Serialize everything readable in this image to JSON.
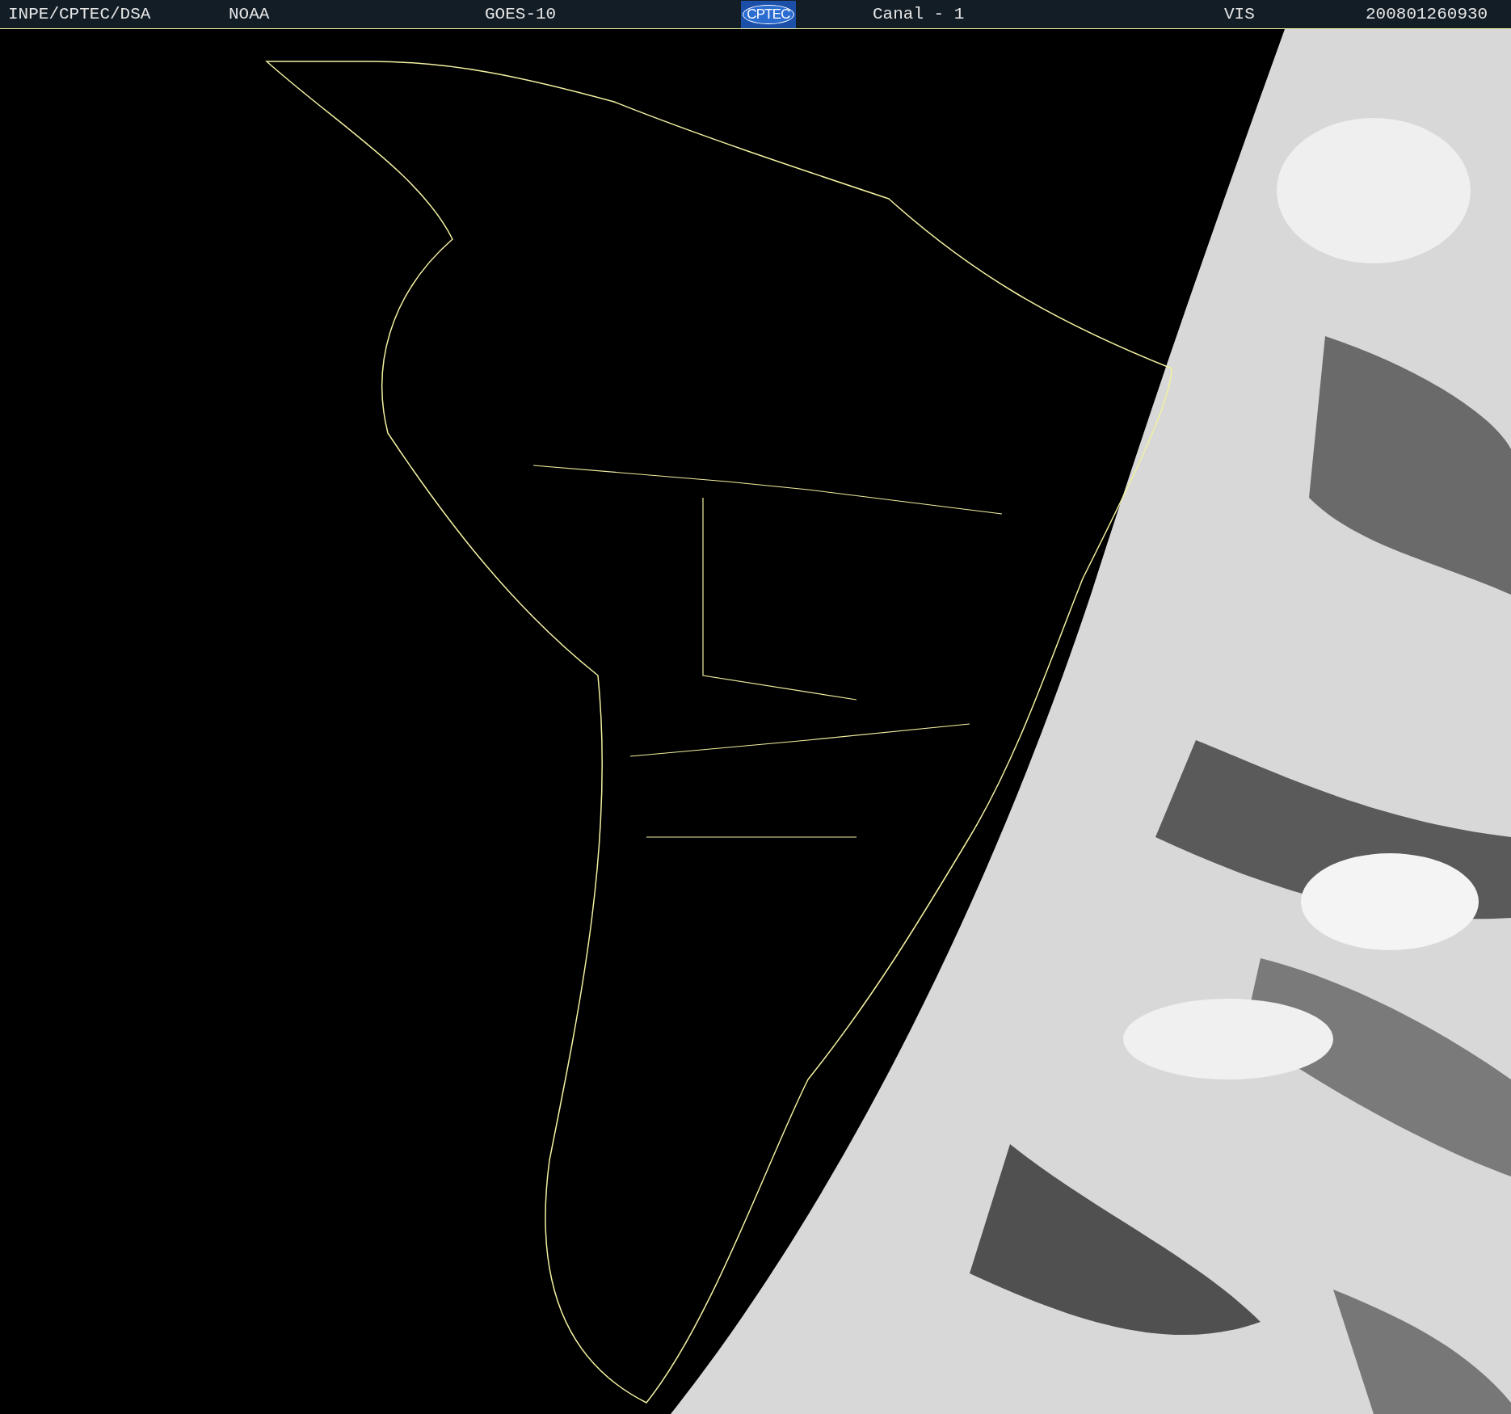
{
  "header": {
    "items": [
      {
        "kind": "text",
        "text": "INPE/CPTEC/DSA"
      },
      {
        "kind": "text",
        "text": "NOAA"
      },
      {
        "kind": "text",
        "text": "GOES-10"
      },
      {
        "kind": "logo",
        "text": "CPTEC"
      },
      {
        "kind": "text",
        "text": "Canal - 1"
      },
      {
        "kind": "text",
        "text": "VIS"
      },
      {
        "kind": "text",
        "text": "200801260930"
      }
    ]
  }
}
